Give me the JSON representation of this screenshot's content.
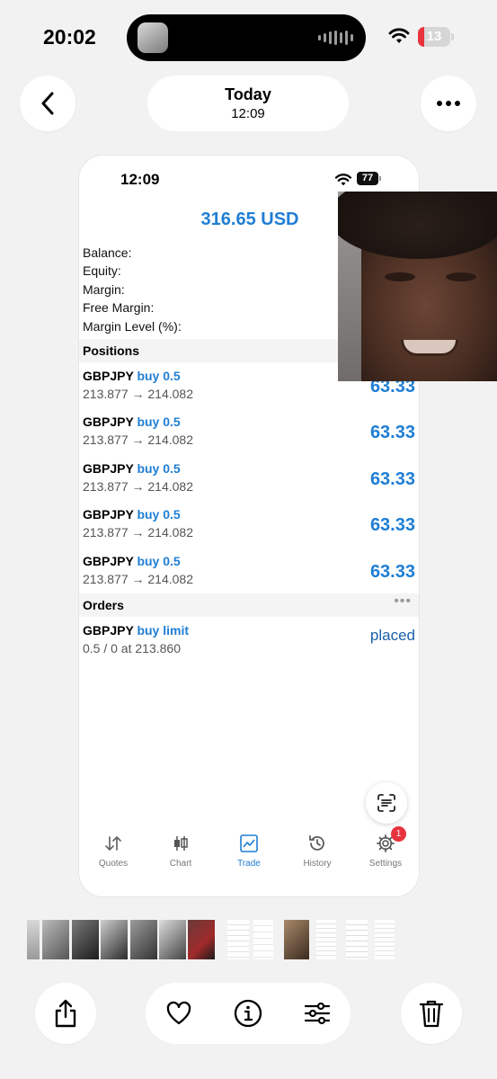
{
  "status_bar": {
    "time": "20:02",
    "battery": "13"
  },
  "header": {
    "title": "Today",
    "subtitle": "12:09"
  },
  "screenshot": {
    "status_time": "12:09",
    "battery": "77",
    "balance_header": "316.65 USD",
    "stats": [
      "Balance:",
      "Equity:",
      "Margin:",
      "Free Margin:",
      "Margin Level (%):"
    ],
    "positions_label": "Positions",
    "positions": [
      {
        "symbol": "GBPJPY",
        "side": "buy 0.5",
        "prices": "213.877 → 214.082",
        "profit": "63.33"
      },
      {
        "symbol": "GBPJPY",
        "side": "buy 0.5",
        "prices": "213.877 → 214.082",
        "profit": "63.33"
      },
      {
        "symbol": "GBPJPY",
        "side": "buy 0.5",
        "prices": "213.877 → 214.082",
        "profit": "63.33"
      },
      {
        "symbol": "GBPJPY",
        "side": "buy 0.5",
        "prices": "213.877 → 214.082",
        "profit": "63.33"
      },
      {
        "symbol": "GBPJPY",
        "side": "buy 0.5",
        "prices": "213.877 → 214.082",
        "profit": "63.33"
      }
    ],
    "orders_label": "Orders",
    "orders_more": "•••",
    "orders": [
      {
        "symbol": "GBPJPY",
        "side": "buy limit",
        "detail": "0.5 / 0 at 213.860",
        "state": "placed"
      }
    ],
    "tabs": [
      {
        "label": "Quotes",
        "icon": "quotes-icon"
      },
      {
        "label": "Chart",
        "icon": "chart-icon"
      },
      {
        "label": "Trade",
        "icon": "trade-icon"
      },
      {
        "label": "History",
        "icon": "history-icon"
      },
      {
        "label": "Settings",
        "icon": "settings-icon"
      }
    ],
    "active_tab": "Trade",
    "settings_badge": "1"
  },
  "colors": {
    "accent": "#1f7ed4",
    "badge": "#e8323c",
    "background": "#f2f2f2"
  }
}
